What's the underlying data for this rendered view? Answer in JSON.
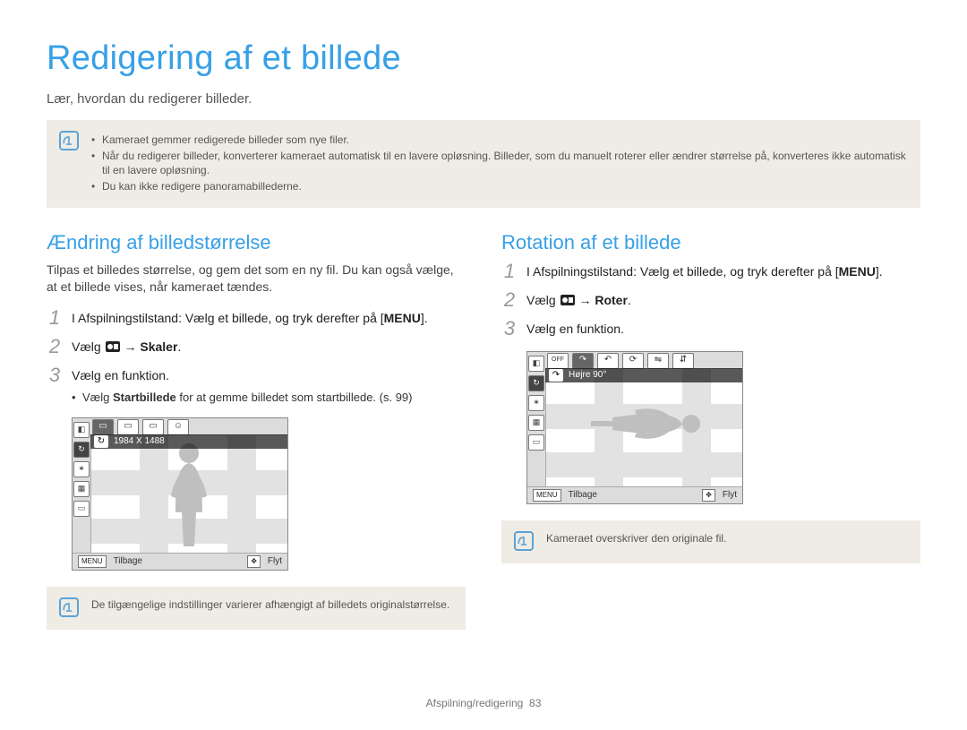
{
  "title": "Redigering af et billede",
  "lead": "Lær, hvordan du redigerer billeder.",
  "topNote": {
    "items": [
      "Kameraet gemmer redigerede billeder som nye filer.",
      "Når du redigerer billeder, konverterer kameraet automatisk til en lavere opløsning. Billeder, som du manuelt roterer eller ændrer størrelse på, konverteres ikke automatisk til en lavere opløsning.",
      "Du kan ikke redigere panoramabillederne."
    ]
  },
  "left": {
    "heading": "Ændring af billedstørrelse",
    "desc": "Tilpas et billedes størrelse, og gem det som en ny fil. Du kan også vælge, at et billede vises, når kameraet tændes.",
    "steps": {
      "s1_prefix": "I Afspilningstilstand: Vælg et billede, og tryk derefter på [",
      "s1_button": "MENU",
      "s1_suffix": "].",
      "s2_prefix": "Vælg ",
      "s2_arrow": " → ",
      "s2_bold": "Skaler",
      "s2_suffix": ".",
      "s3": "Vælg en funktion.",
      "s3_sub_prefix": "Vælg ",
      "s3_sub_bold": "Startbillede",
      "s3_sub_rest": " for at gemme billedet som startbillede. (s. 99)"
    },
    "lcd": {
      "banner": "1984 X 1488",
      "footerBackKey": "MENU",
      "footerBack": "Tilbage",
      "footerMove": "Flyt"
    },
    "bottomNote": "De tilgængelige indstillinger varierer afhængigt af billedets originalstørrelse."
  },
  "right": {
    "heading": "Rotation af et billede",
    "steps": {
      "s1_prefix": "I Afspilningstilstand: Vælg et billede, og tryk derefter på [",
      "s1_button": "MENU",
      "s1_suffix": "].",
      "s2_prefix": "Vælg ",
      "s2_arrow": " → ",
      "s2_bold": "Roter",
      "s2_suffix": ".",
      "s3": "Vælg en funktion."
    },
    "lcd": {
      "banner": "Højre 90°",
      "footerBackKey": "MENU",
      "footerBack": "Tilbage",
      "footerMove": "Flyt"
    },
    "bottomNote": "Kameraet overskriver den originale fil."
  },
  "footer": {
    "section": "Afspilning/redigering",
    "page": "83"
  }
}
